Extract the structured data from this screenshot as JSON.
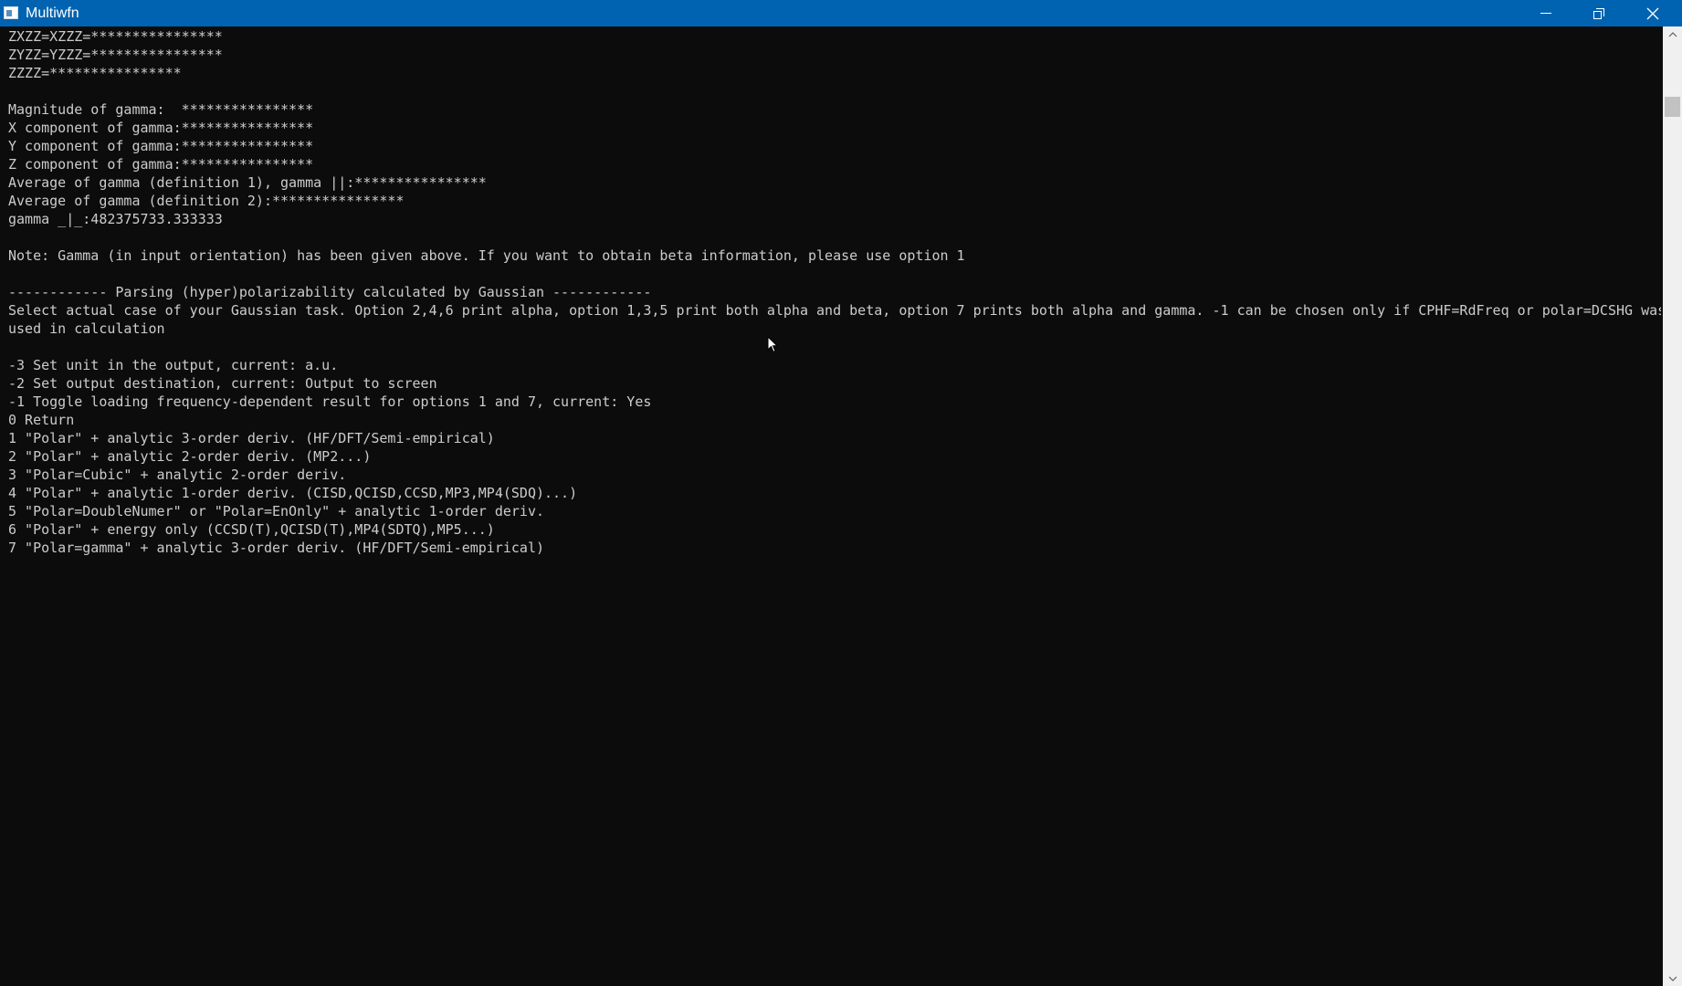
{
  "window": {
    "title": "Multiwfn"
  },
  "scrollbar": {
    "position": 0.06
  },
  "console": {
    "lines": [
      "ZXZZ=XZZZ=****************",
      "ZYZZ=YZZZ=****************",
      "ZZZZ=****************",
      "",
      "Magnitude of gamma:  ****************",
      "X component of gamma:****************",
      "Y component of gamma:****************",
      "Z component of gamma:****************",
      "Average of gamma (definition 1), gamma ||:****************",
      "Average of gamma (definition 2):****************",
      "gamma _|_:482375733.333333",
      "",
      "Note: Gamma (in input orientation) has been given above. If you want to obtain beta information, please use option 1",
      "",
      "------------ Parsing (hyper)polarizability calculated by Gaussian ------------",
      "Select actual case of your Gaussian task. Option 2,4,6 print alpha, option 1,3,5 print both alpha and beta, option 7 prints both alpha and gamma. -1 can be chosen only if CPHF=RdFreq or polar=DCSHG was",
      "used in calculation",
      "",
      "-3 Set unit in the output, current: a.u.",
      "-2 Set output destination, current: Output to screen",
      "-1 Toggle loading frequency-dependent result for options 1 and 7, current: Yes",
      "0 Return",
      "1 \"Polar\" + analytic 3-order deriv. (HF/DFT/Semi-empirical)",
      "2 \"Polar\" + analytic 2-order deriv. (MP2...)",
      "3 \"Polar=Cubic\" + analytic 2-order deriv.",
      "4 \"Polar\" + analytic 1-order deriv. (CISD,QCISD,CCSD,MP3,MP4(SDQ)...)",
      "5 \"Polar=DoubleNumer\" or \"Polar=EnOnly\" + analytic 1-order deriv.",
      "6 \"Polar\" + energy only (CCSD(T),QCISD(T),MP4(SDTQ),MP5...)",
      "7 \"Polar=gamma\" + analytic 3-order deriv. (HF/DFT/Semi-empirical)"
    ]
  },
  "colors": {
    "titlebar": "#0063b1",
    "console_bg": "#0c0c0c",
    "console_text": "#cccccc"
  }
}
